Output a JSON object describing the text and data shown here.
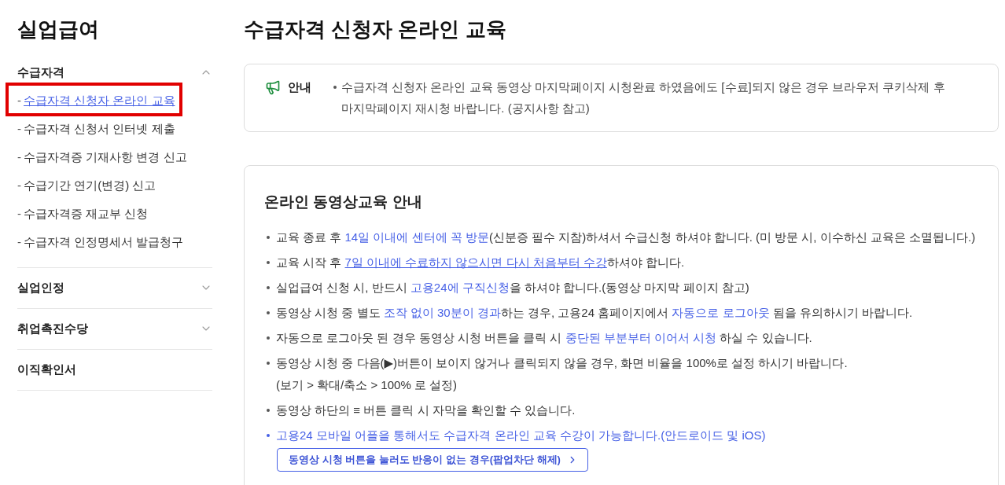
{
  "sidebar": {
    "title": "실업급여",
    "sections": [
      {
        "kind": "group",
        "label": "수급자격",
        "expanded": true,
        "items": [
          {
            "marker": "-",
            "label": "수급자격 신청자 온라인 교육",
            "selected": true
          },
          {
            "marker": "-",
            "label": "수급자격 신청서 인터넷 제출",
            "selected": false
          },
          {
            "marker": "-",
            "label": "수급자격증 기재사항 변경 신고",
            "selected": false
          },
          {
            "marker": "-",
            "label": "수급기간 연기(변경) 신고",
            "selected": false
          },
          {
            "marker": "-",
            "label": "수급자격증 재교부 신청",
            "selected": false
          },
          {
            "marker": "-",
            "label": "수급자격 인정명세서 발급청구",
            "selected": false
          }
        ]
      },
      {
        "kind": "group",
        "label": "실업인정",
        "expanded": false
      },
      {
        "kind": "group",
        "label": "취업촉진수당",
        "expanded": false
      },
      {
        "kind": "link",
        "label": "이직확인서"
      }
    ]
  },
  "main": {
    "title": "수급자격 신청자 온라인 교육",
    "notice": {
      "label": "안내",
      "text": "수급자격 신청자 온라인 교육 동영상 마지막페이지 시청완료 하였음에도 [수료]되지 않은 경우 브라우저 쿠키삭제 후 마지막페이지 재시청 바랍니다. (공지사항 참고)"
    },
    "guide": {
      "title": "온라인 동영상교육 안내",
      "items": [
        {
          "accent": false,
          "segments": [
            {
              "kind": "plain",
              "text": "교육 종료 후 "
            },
            {
              "kind": "emphasis",
              "text": "14일 이내에 센터에 꼭 방문"
            },
            {
              "kind": "plain",
              "text": "(신분증 필수 지참)하셔서 수급신청 하셔야 합니다. (미 방문 시, 이수하신 교육은 소멸됩니다.)"
            }
          ]
        },
        {
          "accent": false,
          "segments": [
            {
              "kind": "plain",
              "text": "교육 시작 후 "
            },
            {
              "kind": "emphasis-underline",
              "text": "7일 이내에 수료하지 않으시면 다시 처음부터 수강"
            },
            {
              "kind": "plain",
              "text": "하셔야 합니다."
            }
          ]
        },
        {
          "accent": false,
          "segments": [
            {
              "kind": "plain",
              "text": "실업급여 신청 시, 반드시 "
            },
            {
              "kind": "emphasis",
              "text": "고용24에 구직신청"
            },
            {
              "kind": "plain",
              "text": "을 하셔야 합니다.(동영상 마지막 페이지 참고)"
            }
          ]
        },
        {
          "accent": false,
          "segments": [
            {
              "kind": "plain",
              "text": "동영상 시청 중 별도 "
            },
            {
              "kind": "emphasis",
              "text": "조작 없이 30분이 경과"
            },
            {
              "kind": "plain",
              "text": "하는 경우, 고용24 홈페이지에서 "
            },
            {
              "kind": "emphasis",
              "text": "자동으로 로그아웃"
            },
            {
              "kind": "plain",
              "text": " 됨을 유의하시기 바랍니다."
            }
          ]
        },
        {
          "accent": false,
          "segments": [
            {
              "kind": "plain",
              "text": "자동으로 로그아웃 된 경우 동영상 시청 버튼을 클릭 시 "
            },
            {
              "kind": "emphasis",
              "text": "중단된 부분부터 이어서 시청"
            },
            {
              "kind": "plain",
              "text": " 하실 수 있습니다."
            }
          ]
        },
        {
          "accent": false,
          "segments": [
            {
              "kind": "plain",
              "text": "동영상 시청 중 다음(▶)버튼이 보이지 않거나 클릭되지 않을 경우, 화면 비율을 100%로 설정 하시기 바랍니다."
            }
          ],
          "note": "(보기 > 확대/축소 > 100% 로 설정)"
        },
        {
          "accent": false,
          "segments": [
            {
              "kind": "plain",
              "text": "동영상 하단의 ≡ 버튼 클릭 시 자막을 확인할 수 있습니다."
            }
          ]
        },
        {
          "accent": true,
          "segments": [
            {
              "kind": "emphasis",
              "text": "고용24 모바일 어플을 통해서도 수급자격 온라인 교육 수강이 가능합니다.(안드로이드 및 iOS)"
            }
          ]
        }
      ],
      "popup_button": {
        "label": "동영상 시청 버튼을 눌러도 반응이 없는 경우(팝업차단 해제)"
      }
    }
  }
}
